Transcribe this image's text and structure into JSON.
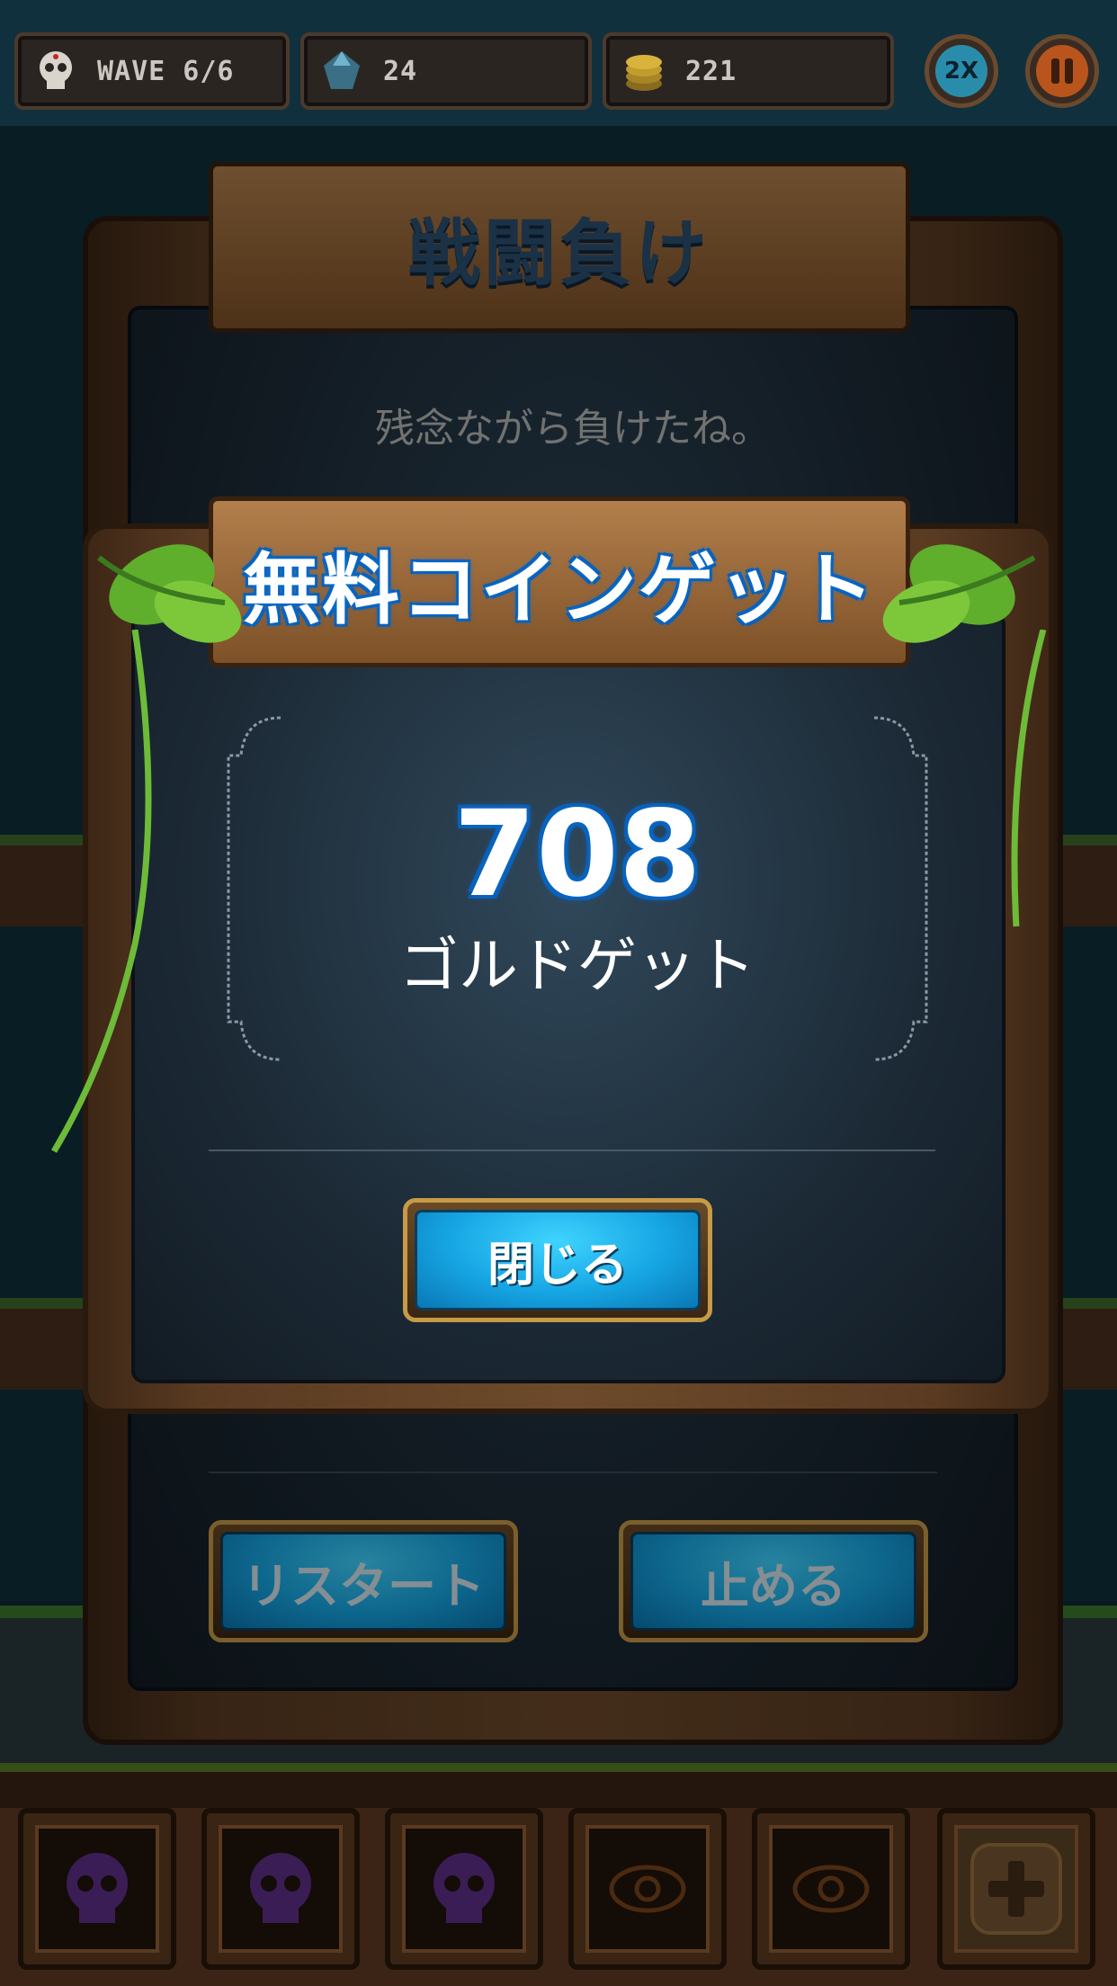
{
  "hud": {
    "wave": "WAVE 6/6",
    "gems": "24",
    "coins": "221",
    "speed": "2X"
  },
  "defeat_dialog": {
    "title": "戦闘負け",
    "message_line1": "残念ながら負けたね。",
    "restart_label": "リスタート",
    "quit_label": "止める"
  },
  "reward_dialog": {
    "title": "無料コインゲット",
    "amount": "708",
    "amount_label": "ゴルドゲット",
    "close_label": "閉じる"
  },
  "colors": {
    "accent": "#16a5e3",
    "title_glow": "#0a6fd1",
    "wood": "#9b6a3b"
  },
  "skill_slots": [
    {
      "icon": "skull-icon",
      "state": "locked"
    },
    {
      "icon": "skull-icon",
      "state": "locked"
    },
    {
      "icon": "skull-icon",
      "state": "locked"
    },
    {
      "icon": "eye-icon",
      "state": "locked"
    },
    {
      "icon": "eye-icon",
      "state": "locked"
    },
    {
      "icon": "plus-icon",
      "state": "add"
    }
  ]
}
